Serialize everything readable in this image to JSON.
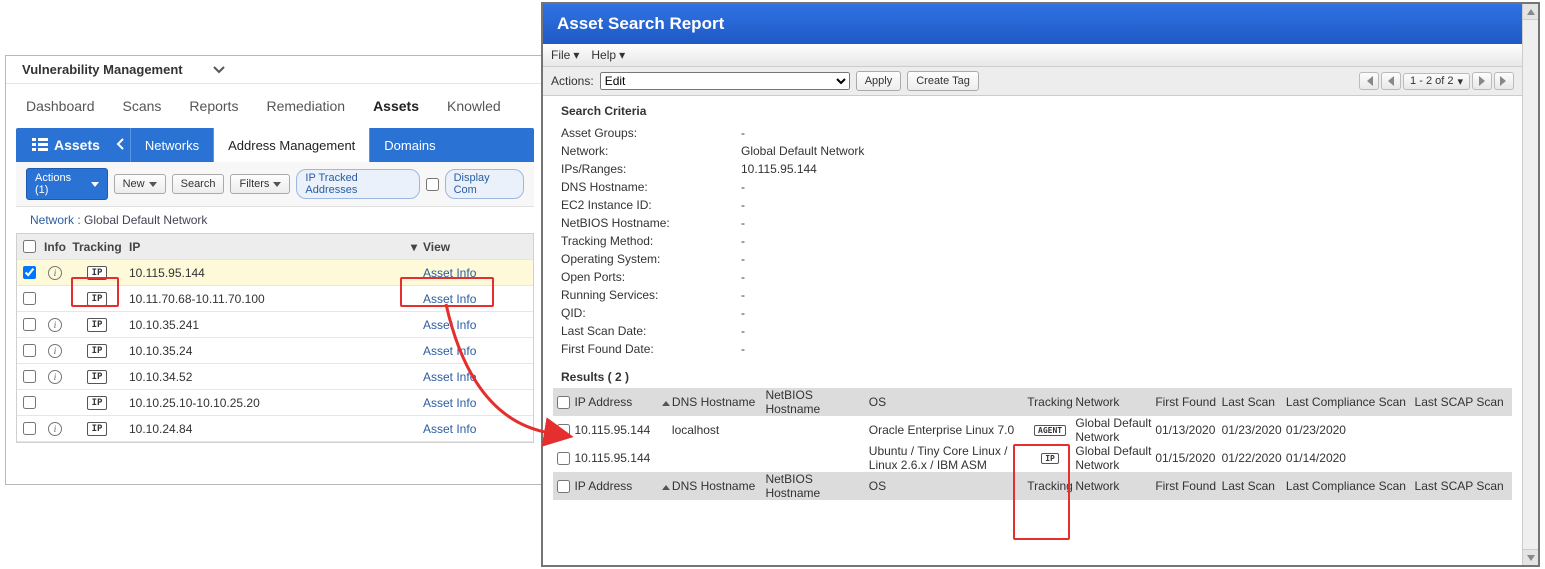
{
  "app": {
    "module_label": "Vulnerability Management",
    "nav_tabs": [
      "Dashboard",
      "Scans",
      "Reports",
      "Remediation",
      "Assets",
      "Knowled"
    ],
    "active_nav_index": 4,
    "subnav": {
      "label": "Assets",
      "tabs": [
        "Networks",
        "Address Management",
        "Domains"
      ],
      "active_index": 1
    },
    "toolbar": {
      "actions_label": "Actions (1)",
      "new_label": "New",
      "search_label": "Search",
      "filters_label": "Filters",
      "ip_tracked_label": "IP Tracked Addresses",
      "display_label": "Display Com"
    },
    "network_line": {
      "prefix": "Network :",
      "value": "Global Default Network"
    },
    "grid": {
      "headers": {
        "info": "Info",
        "tracking": "Tracking",
        "ip": "IP",
        "view": "View"
      },
      "rows": [
        {
          "checked": true,
          "has_info": true,
          "track": "IP",
          "ip": "10.115.95.144",
          "view": "Asset Info",
          "sel": true
        },
        {
          "checked": false,
          "has_info": false,
          "track": "IP",
          "ip": "10.11.70.68-10.11.70.100",
          "view": "Asset Info"
        },
        {
          "checked": false,
          "has_info": true,
          "track": "IP",
          "ip": "10.10.35.241",
          "view": "Asset Info"
        },
        {
          "checked": false,
          "has_info": true,
          "track": "IP",
          "ip": "10.10.35.24",
          "view": "Asset Info"
        },
        {
          "checked": false,
          "has_info": true,
          "track": "IP",
          "ip": "10.10.34.52",
          "view": "Asset Info"
        },
        {
          "checked": false,
          "has_info": false,
          "track": "IP",
          "ip": "10.10.25.10-10.10.25.20",
          "view": "Asset Info"
        },
        {
          "checked": false,
          "has_info": true,
          "track": "IP",
          "ip": "10.10.24.84",
          "view": "Asset Info"
        }
      ]
    }
  },
  "report": {
    "title": "Asset Search Report",
    "menus": {
      "file": "File",
      "help": "Help"
    },
    "actions": {
      "label": "Actions:",
      "select_value": "Edit",
      "apply": "Apply",
      "create_tag": "Create Tag"
    },
    "pager": {
      "range": "1 - 2 of 2"
    },
    "criteria_title": "Search Criteria",
    "criteria": [
      {
        "label": "Asset Groups:",
        "value": "-"
      },
      {
        "label": "Network:",
        "value": "Global Default Network"
      },
      {
        "label": "IPs/Ranges:",
        "value": "10.115.95.144"
      },
      {
        "label": "DNS Hostname:",
        "value": "-"
      },
      {
        "label": "EC2 Instance ID:",
        "value": "-"
      },
      {
        "label": "NetBIOS Hostname:",
        "value": "-"
      },
      {
        "label": "Tracking Method:",
        "value": "-"
      },
      {
        "label": "Operating System:",
        "value": "-"
      },
      {
        "label": "Open Ports:",
        "value": "-"
      },
      {
        "label": "Running Services:",
        "value": "-"
      },
      {
        "label": "QID:",
        "value": "-"
      },
      {
        "label": "Last Scan Date:",
        "value": "-"
      },
      {
        "label": "First Found Date:",
        "value": "-"
      }
    ],
    "results_title": "Results ( 2 )",
    "results_headers": {
      "ip": "IP Address",
      "dns": "DNS Hostname",
      "nb": "NetBIOS Hostname",
      "os": "OS",
      "track": "Tracking",
      "net": "Network",
      "ff": "First Found",
      "ls": "Last Scan",
      "lcs": "Last Compliance Scan",
      "lss": "Last SCAP Scan"
    },
    "results_rows": [
      {
        "ip": "10.115.95.144",
        "dns": "localhost",
        "nb": "",
        "os": "Oracle Enterprise Linux 7.0",
        "track": "AGENT",
        "net": "Global Default Network",
        "ff": "01/13/2020",
        "ls": "01/23/2020",
        "lcs": "01/23/2020",
        "lss": ""
      },
      {
        "ip": "10.115.95.144",
        "dns": "",
        "nb": "",
        "os": "Ubuntu / Tiny Core Linux / Linux 2.6.x / IBM ASM",
        "track": "IP",
        "net": "Global Default Network",
        "ff": "01/15/2020",
        "ls": "01/22/2020",
        "lcs": "01/14/2020",
        "lss": ""
      }
    ]
  }
}
